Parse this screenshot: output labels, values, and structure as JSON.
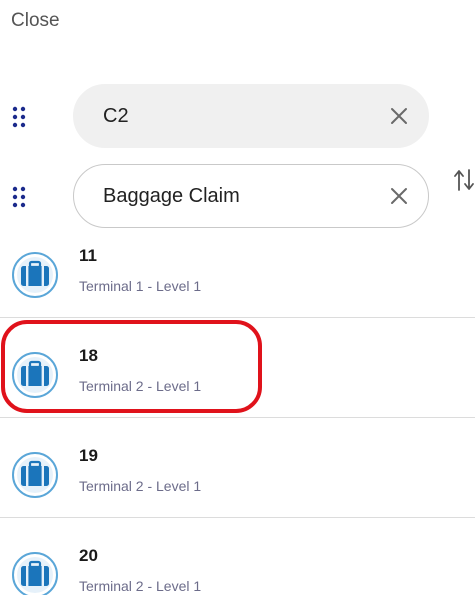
{
  "header": {
    "close_label": "Close"
  },
  "route": {
    "stops": [
      {
        "value": "C2"
      },
      {
        "value": "Baggage Claim"
      }
    ]
  },
  "results": [
    {
      "number": "11",
      "location": "Terminal 1 - Level 1",
      "icon": "baggage-claim-icon"
    },
    {
      "number": "18",
      "location": "Terminal 2 - Level 1",
      "icon": "baggage-claim-icon"
    },
    {
      "number": "19",
      "location": "Terminal 2 - Level 1",
      "icon": "baggage-claim-icon"
    },
    {
      "number": "20",
      "location": "Terminal 2 - Level 1",
      "icon": "baggage-claim-icon"
    }
  ],
  "colors": {
    "accent": "#1b75bb",
    "icon_ring": "#5aa6d8",
    "handle": "#1b2a8c",
    "highlight": "#e0121b"
  }
}
